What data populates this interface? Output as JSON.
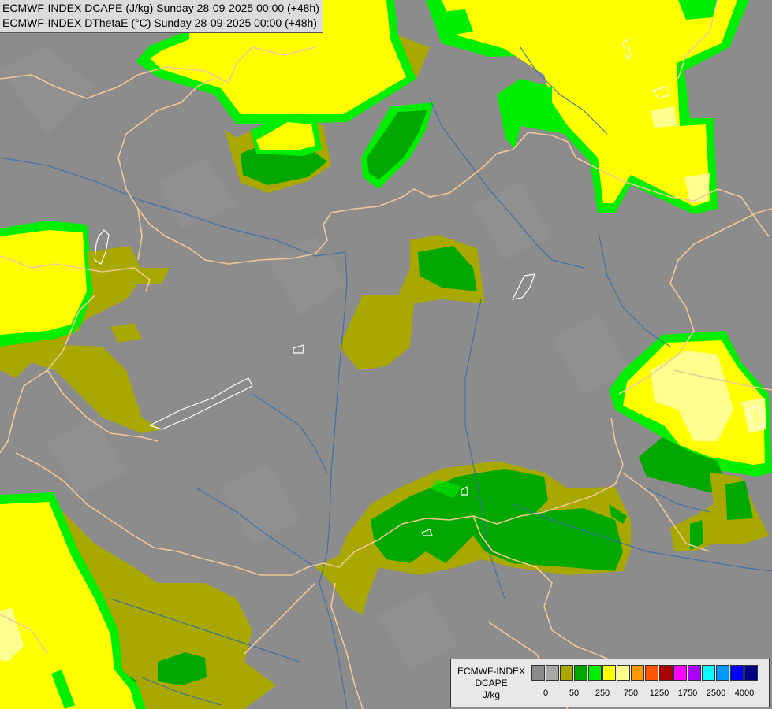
{
  "header": {
    "line1": "ECMWF-INDEX DCAPE (J/kg) Sunday 28-09-2025 00:00 (+48h)",
    "line2": "ECMWF-INDEX DThetaE (°C) Sunday 28-09-2025 00:00 (+48h)"
  },
  "legend": {
    "name_line1": "ECMWF-INDEX",
    "name_line2": "DCAPE",
    "name_line3": "J/kg",
    "bins": [
      "#8c8c8c",
      "#a8a8a8",
      "#a8a800",
      "#00a800",
      "#00ee00",
      "#ffff00",
      "#ffff90",
      "#ff9900",
      "#ff5500",
      "#aa0000",
      "#ff00ff",
      "#aa00ff",
      "#00ffff",
      "#0099ff",
      "#0000ff",
      "#000088"
    ],
    "ticks": [
      "0",
      "50",
      "250",
      "750",
      "1250",
      "1750",
      "2500",
      "4000"
    ]
  },
  "colors": {
    "background": "#8c8c8c",
    "olive": "#a8a800",
    "dark_green": "#00a800",
    "green": "#00ee00",
    "yellow": "#ffff00",
    "light_yellow": "#ffff90",
    "borders": "#f0c896",
    "rivers": "#3a6ea8",
    "lakes": "#ffffff"
  }
}
